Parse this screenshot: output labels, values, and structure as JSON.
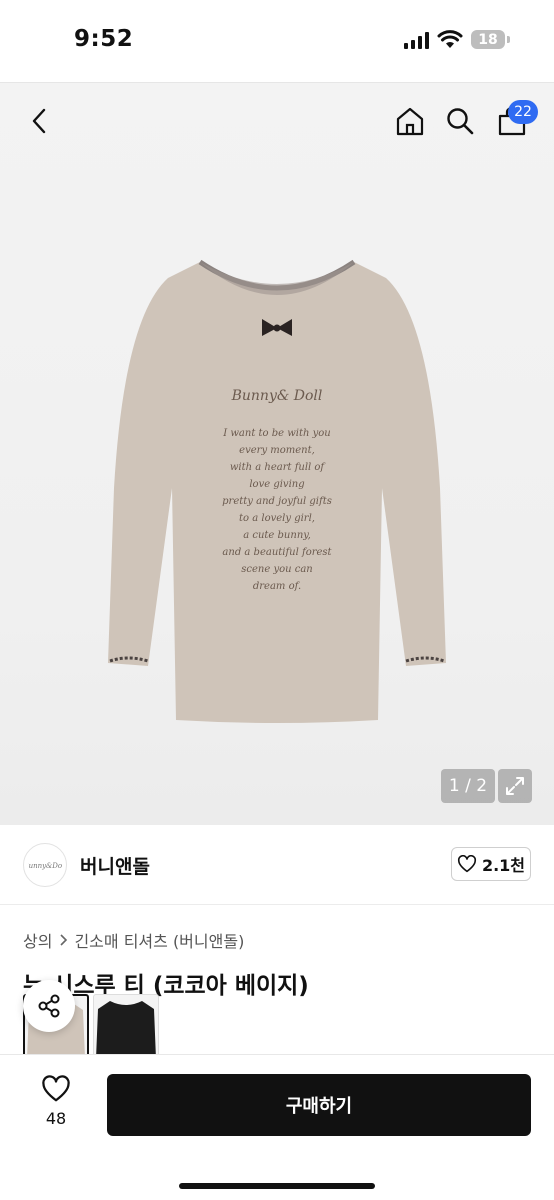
{
  "status_bar": {
    "time": "9:52",
    "battery": "18"
  },
  "header": {
    "cart_count": "22",
    "icons": [
      "back-icon",
      "home-icon",
      "search-icon",
      "cart-icon"
    ]
  },
  "gallery": {
    "pager": "1 / 2",
    "print_text": {
      "logo": "Bunny& Doll",
      "lines": [
        "I want to be with you",
        "every moment,",
        "with a heart full of",
        "love giving",
        "pretty and joyful gifts",
        "to a lovely girl,",
        "a cute bunny,",
        "and a beautiful forest",
        "scene you can",
        "dream of."
      ]
    },
    "colors": {
      "shirt": "#cfc4b9",
      "trim": "#7a7270",
      "text": "#6b5a4e"
    }
  },
  "brand": {
    "name": "버니앤돌",
    "logo_text": "Bunny&Doll",
    "likes": "2.1천"
  },
  "breadcrumb": {
    "category": "상의",
    "subcategory": "긴소매 티셔츠 (버니앤돌)"
  },
  "product": {
    "title": "누 시스루 티 (코코아 베이지)"
  },
  "color_options": [
    {
      "name": "cocoa beige",
      "color": "#cfc4b9",
      "selected": true
    },
    {
      "name": "black",
      "color": "#1c1c1c",
      "selected": false
    }
  ],
  "bottom_bar": {
    "wish_count": "48",
    "buy_label": "구매하기"
  }
}
